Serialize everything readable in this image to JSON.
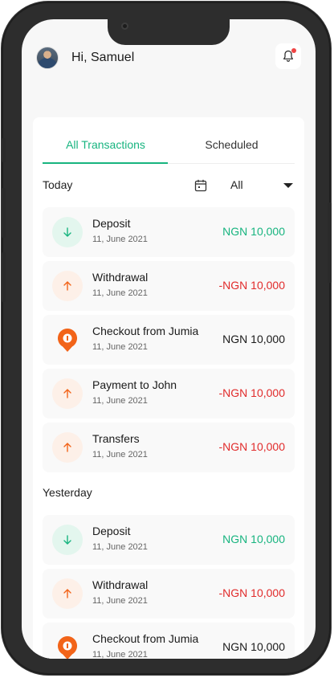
{
  "header": {
    "greeting": "Hi, Samuel"
  },
  "tabs": [
    {
      "label": "All Transactions",
      "active": true
    },
    {
      "label": "Scheduled",
      "active": false
    }
  ],
  "filters": {
    "today_label": "Today",
    "type_value": "All"
  },
  "sections": {
    "today": [
      {
        "title": "Deposit",
        "date": "11, June 2021",
        "amount": "NGN 10,000",
        "kind": "in"
      },
      {
        "title": "Withdrawal",
        "date": "11, June 2021",
        "amount": "-NGN 10,000",
        "kind": "out"
      },
      {
        "title": "Checkout from Jumia",
        "date": "11, June 2021",
        "amount": "NGN 10,000",
        "kind": "jumia"
      },
      {
        "title": "Payment to John",
        "date": "11, June 2021",
        "amount": "-NGN 10,000",
        "kind": "out"
      },
      {
        "title": "Transfers",
        "date": "11, June 2021",
        "amount": "-NGN 10,000",
        "kind": "out"
      }
    ],
    "yesterday_label": "Yesterday",
    "yesterday": [
      {
        "title": "Deposit",
        "date": "11, June 2021",
        "amount": "NGN 10,000",
        "kind": "in"
      },
      {
        "title": "Withdrawal",
        "date": "11, June 2021",
        "amount": "-NGN 10,000",
        "kind": "out"
      },
      {
        "title": "Checkout from Jumia",
        "date": "11, June 2021",
        "amount": "NGN 10,000",
        "kind": "jumia"
      }
    ]
  },
  "colors": {
    "accent": "#17b47f",
    "negative": "#e12b2b",
    "jumia": "#f26419"
  },
  "icons": {
    "in": "arrow-down-icon",
    "out": "arrow-up-icon",
    "jumia": "jumia-logo-icon",
    "bell": "bell-icon",
    "calendar": "calendar-icon"
  }
}
